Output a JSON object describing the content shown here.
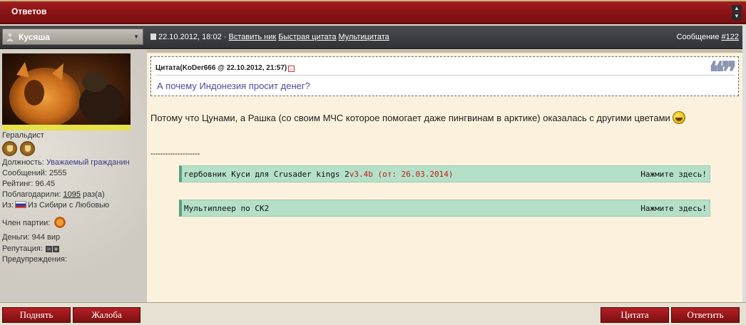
{
  "header": {
    "title": "Ответов"
  },
  "post": {
    "user_name": "Кусяша",
    "info_prefix": "22.10.2012, 18:02 ·",
    "actions": [
      "Вставить ник",
      "Быстрая цитата",
      "Мультицитата"
    ],
    "message_label": "Сообщение",
    "message_number": "#122"
  },
  "profile": {
    "title": "Геральдист",
    "position_label": "Должность:",
    "position_value": "Уважаемый гражданин",
    "messages": "Сообщений: 2555",
    "rating": "Рейтинг: 96.45",
    "thanks_label": "Поблагодарили:",
    "thanks_count": "1095",
    "thanks_suffix": "раз(а)",
    "from_label": "Из:",
    "from_value": "Из Сибири с Любовью",
    "party_label": "Член партии:",
    "money": "Деньги: 944 вир",
    "reputation_label": "Репутация:",
    "warnings_label": "Предупреждения:",
    "rep_minus": "−",
    "rep_plus": "+"
  },
  "quote": {
    "header": "Цитата(KoDer666 @ 22.10.2012, 21:57)",
    "text": "А почему Индонезия просит денег?"
  },
  "body_text": "Потому что Цунами, а Рашка (со своим МЧС которое помогает даже пингвинам в арктике) оказалась с другими цветами",
  "separator": "--------------------",
  "spoilers": [
    {
      "text": "гербовник Куси для Crusader kings 2",
      "version": "v3.4b (от: 26.03.2014)",
      "click": "Нажмите здесь!"
    },
    {
      "text": "Мультиплеер по СК2",
      "version": "",
      "click": "Нажмите здесь!"
    }
  ],
  "buttons": {
    "raise": "Поднять",
    "complain": "Жалоба",
    "quote": "Цитата",
    "reply": "Ответить"
  },
  "colors": {
    "header_red": "#8a1417",
    "button_red": "#9a1719",
    "spoiler_green": "#b4e0c8",
    "content_bg": "#fbf1dc",
    "quote_text": "#4b4ba0"
  }
}
